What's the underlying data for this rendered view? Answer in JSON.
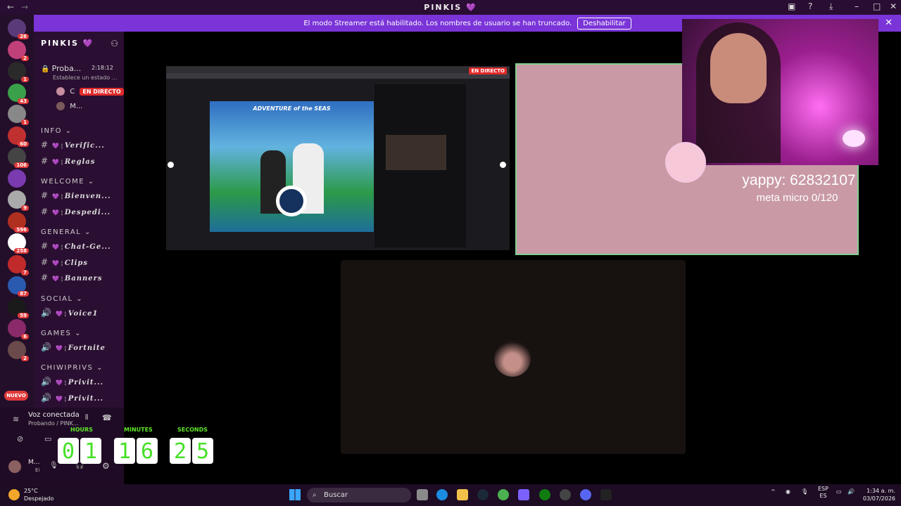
{
  "app": {
    "title": "PINKIS 💜"
  },
  "banner": {
    "text": "El modo Streamer está habilitado. Los nombres de usuario se han truncado.",
    "button": "Deshabilitar"
  },
  "servers": [
    {
      "badge": "26"
    },
    {
      "badge": "2"
    },
    {
      "badge": "1"
    },
    {
      "badge": "43"
    },
    {
      "badge": "1"
    },
    {
      "badge": "60"
    },
    {
      "badge": "106"
    },
    {
      "badge": ""
    },
    {
      "badge": "9"
    },
    {
      "badge": "596"
    },
    {
      "badge": "258"
    },
    {
      "badge": "7"
    },
    {
      "badge": "87"
    },
    {
      "badge": "59"
    },
    {
      "badge": "6"
    },
    {
      "badge": "2"
    }
  ],
  "new_label": "NUEVO",
  "guild": {
    "name": "PINKIS 💜"
  },
  "voice_channel": {
    "name": "Proba...",
    "time": "2:18:12",
    "status": "Establece un estado ...",
    "member1": "C",
    "live": "EN DIRECTO",
    "member2": "M..."
  },
  "categories": [
    {
      "name": "INFO",
      "channels": [
        "Verific...",
        "Reglas"
      ]
    },
    {
      "name": "WELCOME",
      "channels": [
        "Bienven...",
        "Despedi..."
      ]
    },
    {
      "name": "GENERAL",
      "channels": [
        "Chat-Ge...",
        "Clips",
        "Banners"
      ]
    },
    {
      "name": "SOCIAL",
      "channels": [
        "Voice1"
      ]
    },
    {
      "name": "GAMES",
      "channels": [
        "Fortnite"
      ]
    },
    {
      "name": "CHIWIPRIVS",
      "channels": [
        "Privit...",
        "Privit..."
      ]
    }
  ],
  "voice_status": {
    "title": "Voz conectada",
    "subtitle": "Probando / PINK..."
  },
  "user": {
    "name": "M...",
    "sub": "Ei"
  },
  "timer": {
    "hours_label": "HOURS",
    "minutes_label": "MINUTES",
    "seconds_label": "SECONDS",
    "digits": [
      "0",
      "1",
      "1",
      "6",
      "2",
      "5"
    ]
  },
  "stream": {
    "live_tag": "EN DIRECTO",
    "photo_title": "ADVENTURE of the SEAS"
  },
  "overlay": {
    "yappy": "yappy: 62832107",
    "meta": "meta micro 0/120"
  },
  "taskbar": {
    "temp": "25°C",
    "weather": "Despejado",
    "search": "Buscar",
    "lang1": "ESP",
    "lang2": "ES",
    "time": "1:34 a. m.",
    "date": "03/07/2026"
  }
}
